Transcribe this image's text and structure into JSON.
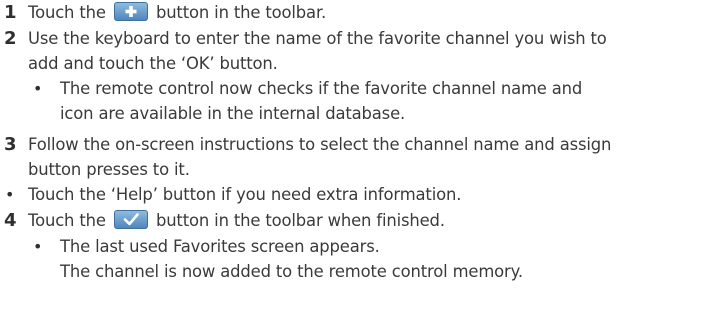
{
  "steps": [
    {
      "number": "1",
      "before_icon": "Touch the",
      "icon": "plus-icon",
      "after_icon": "button in the toolbar."
    },
    {
      "number": "2",
      "lines": [
        "Use the keyboard to enter the name of the favorite channel you wish to",
        "add and touch the ‘OK’ button."
      ],
      "sub_bullet": [
        "The remote control now checks if the favorite channel name and",
        "icon are available in the internal database."
      ]
    },
    {
      "number": "3",
      "lines": [
        "Follow the on-screen instructions to select the channel name and assign",
        "button presses to it."
      ]
    },
    {
      "bullet_text": "Touch the ‘Help’ button if you need extra information."
    },
    {
      "number": "4",
      "before_icon": "Touch the",
      "icon": "checkmark-icon",
      "after_icon": "button in the toolbar when finished.",
      "sub_bullet": [
        "The last used Favorites screen appears.",
        "The channel is now added to the remote control memory."
      ]
    }
  ],
  "bullet_symbol": "•",
  "colors": {
    "text": "#3a3a3a",
    "icon_button_top": "#8fbbe0",
    "icon_button_bottom": "#4f86bb"
  }
}
